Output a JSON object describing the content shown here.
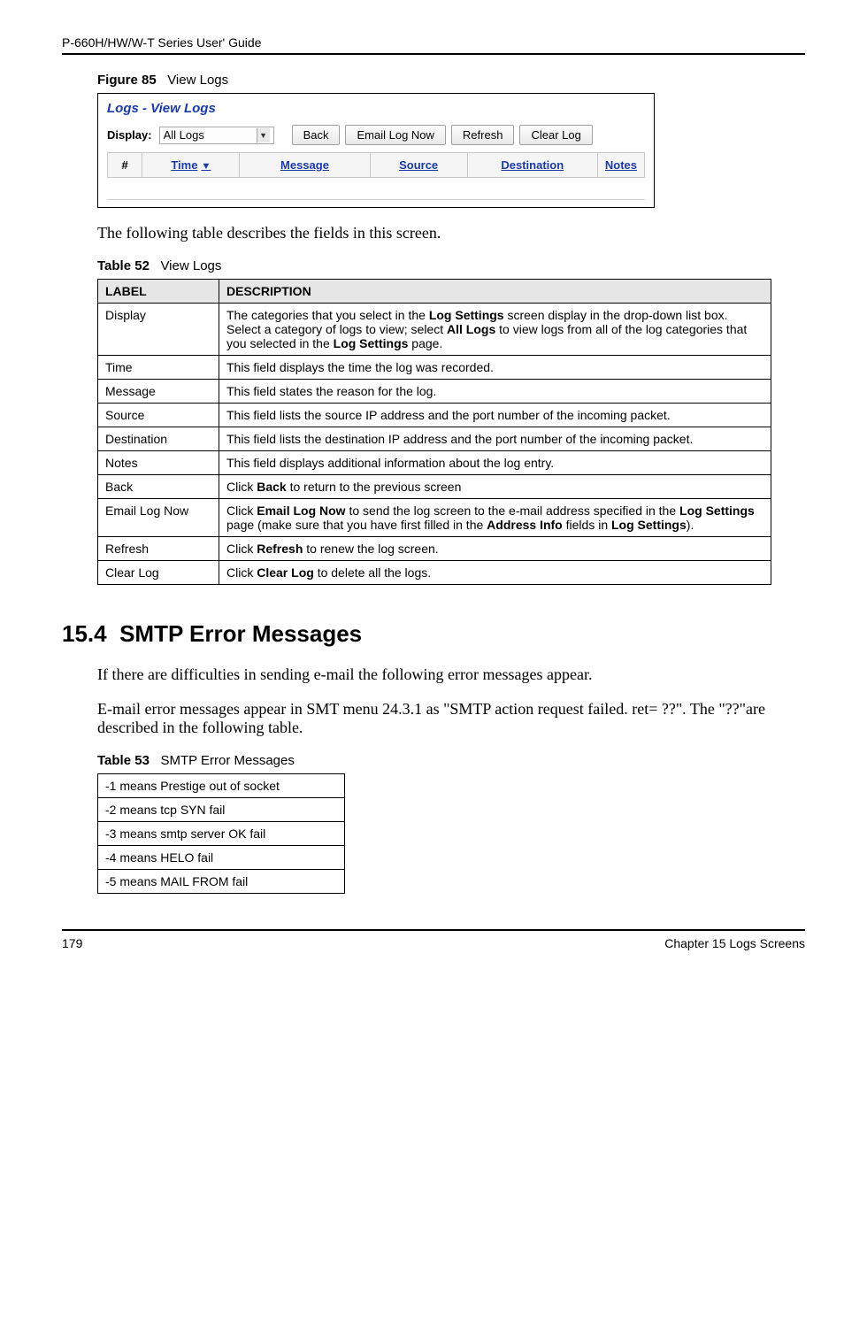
{
  "header": {
    "guide_title": "P-660H/HW/W-T Series User' Guide"
  },
  "figure": {
    "label": "Figure 85",
    "caption": "View Logs"
  },
  "screenshot": {
    "window_title": "Logs - View Logs",
    "display_label": "Display:",
    "display_value": "All Logs",
    "buttons": {
      "back": "Back",
      "email_now": "Email Log Now",
      "refresh": "Refresh",
      "clear": "Clear Log"
    },
    "columns": {
      "hash": "#",
      "time": "Time",
      "message": "Message",
      "source": "Source",
      "destination": "Destination",
      "notes": "Notes"
    }
  },
  "intro_text": "The following table describes the fields in this screen.",
  "table52": {
    "label": "Table 52",
    "caption": "View Logs",
    "head_label": "LABEL",
    "head_desc": "DESCRIPTION",
    "rows": [
      {
        "label": "Display",
        "desc_line1": "The categories that you select in the ",
        "desc_bold1": "Log Settings",
        "desc_line2": " screen display in the drop-down list box.",
        "desc_line3": "Select a category of logs to view; select ",
        "desc_bold2": "All Logs",
        "desc_line4": " to view logs from all of the log categories that you selected in the ",
        "desc_bold3": "Log Settings",
        "desc_line5": " page."
      },
      {
        "label": "Time",
        "desc": "This field displays the time the log was recorded."
      },
      {
        "label": "Message",
        "desc": "This field states the reason for the log."
      },
      {
        "label": "Source",
        "desc": "This field lists the source IP address and the port number of the incoming packet."
      },
      {
        "label": "Destination",
        "desc": "This field lists the destination IP address and the port number of the incoming packet."
      },
      {
        "label": "Notes",
        "desc": "This field displays additional information about the log entry."
      },
      {
        "label": "Back",
        "desc_pre": "Click ",
        "desc_bold": "Back",
        "desc_post": " to return to the previous screen"
      },
      {
        "label": "Email Log Now",
        "desc_pre": "Click ",
        "desc_bold1": "Email Log Now",
        "desc_mid1": " to send the log screen to the e-mail address specified in the ",
        "desc_bold2": "Log Settings",
        "desc_mid2": " page (make sure that you have first filled in the ",
        "desc_bold3": "Address Info",
        "desc_mid3": " fields in ",
        "desc_bold4": "Log Settings",
        "desc_end": ")."
      },
      {
        "label": "Refresh",
        "desc_pre": "Click ",
        "desc_bold": "Refresh",
        "desc_post": " to renew the log screen."
      },
      {
        "label": "Clear Log",
        "desc_pre": "Click ",
        "desc_bold": "Clear Log",
        "desc_post": " to delete all the logs."
      }
    ]
  },
  "section": {
    "number": "15.4",
    "title": "SMTP Error Messages"
  },
  "section_p1": "If there are difficulties in sending e-mail the following error messages appear.",
  "section_p2": "E-mail error messages appear in SMT menu 24.3.1 as \"SMTP action request failed. ret= ??\". The \"??\"are described in the following table.",
  "table53": {
    "label": "Table 53",
    "caption": "SMTP Error Messages",
    "rows": [
      "-1 means Prestige out of socket",
      "-2 means tcp SYN fail",
      "-3 means smtp server OK fail",
      "-4 means HELO fail",
      "-5 means MAIL FROM fail"
    ]
  },
  "footer": {
    "page": "179",
    "chapter": "Chapter 15 Logs Screens"
  }
}
